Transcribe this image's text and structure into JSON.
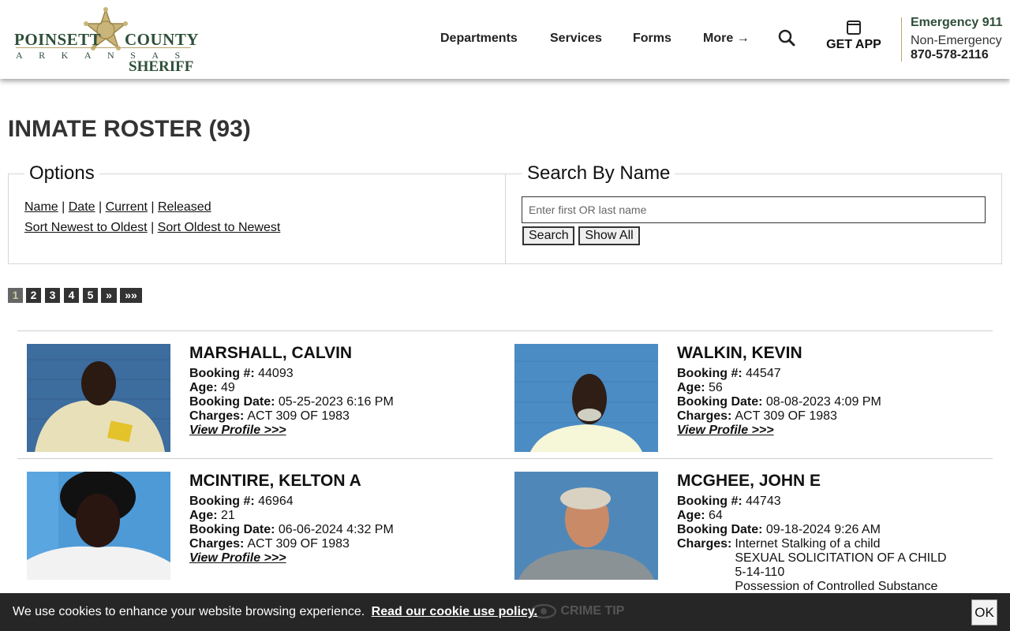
{
  "header": {
    "logo": {
      "line1_left": "POINSETT",
      "line1_right": "COUNTY",
      "line2": "ARKANSAS",
      "line3": "SHERIFF"
    },
    "nav": [
      "Departments",
      "Services",
      "Forms",
      "More"
    ],
    "get_app": "GET APP",
    "emergency": {
      "label": "Emergency 911",
      "non_label": "Non-Emergency",
      "phone": "870-578-2116"
    }
  },
  "page": {
    "title": "INMATE ROSTER (93)"
  },
  "options": {
    "legend": "Options",
    "row1": [
      "Name",
      "Date",
      "Current",
      "Released"
    ],
    "row2": [
      "Sort Newest to Oldest",
      "Sort Oldest to Newest"
    ]
  },
  "search": {
    "legend": "Search By Name",
    "placeholder": "Enter first OR last name",
    "search_label": "Search",
    "show_all_label": "Show All"
  },
  "pager": [
    "1",
    "2",
    "3",
    "4",
    "5",
    "»",
    "»»"
  ],
  "labels": {
    "booking": "Booking #:",
    "age": "Age:",
    "date": "Booking Date:",
    "charges": "Charges:",
    "view": "View Profile >>>"
  },
  "inmates": [
    {
      "name": "MARSHALL, CALVIN",
      "booking": "44093",
      "age": "49",
      "date": "05-25-2023 6:16 PM",
      "charges": [
        "ACT 309 OF 1983"
      ]
    },
    {
      "name": "WALKIN, KEVIN",
      "booking": "44547",
      "age": "56",
      "date": "08-08-2023 4:09 PM",
      "charges": [
        "ACT 309 OF 1983"
      ]
    },
    {
      "name": "MCINTIRE, KELTON A",
      "booking": "46964",
      "age": "21",
      "date": "06-06-2024 4:32 PM",
      "charges": [
        "ACT 309 OF 1983"
      ]
    },
    {
      "name": "MCGHEE, JOHN E",
      "booking": "44743",
      "age": "64",
      "date": "09-18-2024 9:26 AM",
      "charges": [
        "Internet Stalking of a child",
        "SEXUAL SOLICITATION OF A CHILD 5-14-110",
        "Possession of Controlled Substance"
      ]
    }
  ],
  "cookie": {
    "message": "We use cookies to enhance your website browsing experience.",
    "link": "Read our cookie use policy.",
    "ok": "OK",
    "crime_tip": "CRIME TIP"
  }
}
